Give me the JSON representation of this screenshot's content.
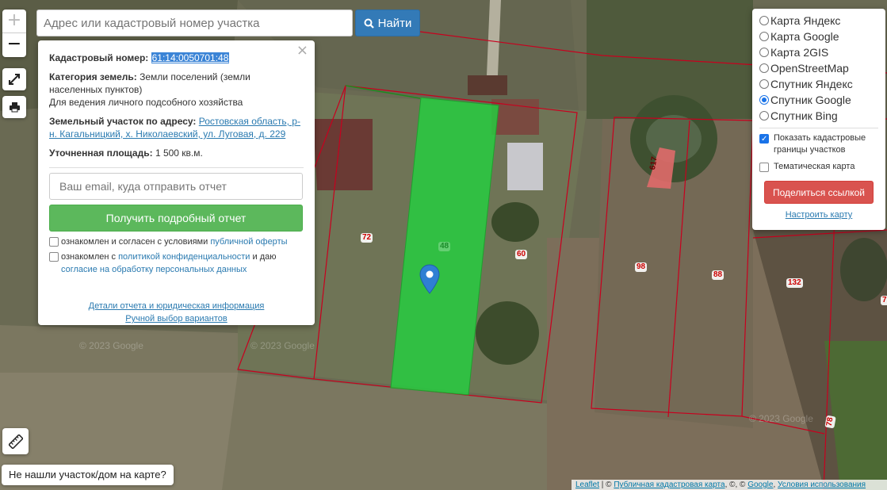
{
  "search": {
    "placeholder": "Адрес или кадастровый номер участка",
    "button_label": "Найти",
    "button_icon": "search-icon"
  },
  "zoom": {
    "in": "+",
    "out": "−"
  },
  "toolbar": {
    "fullscreen_icon": "expand-icon",
    "print_icon": "printer-icon",
    "ruler_icon": "ruler-icon"
  },
  "popup": {
    "close": "×",
    "cadnum_label": "Кадастровый номер:",
    "cadnum_value": "61:14:0050701:48",
    "category_label": "Категория земель:",
    "category_value": "Земли поселений (земли населенных пунктов)",
    "usage": "Для ведения личного подсобного хозяйства",
    "address_label": "Земельный участок по адресу:",
    "address_value": "Ростовская область, р-н. Кагальницкий, х. Николаевский, ул. Луговая, д. 229",
    "area_label": "Уточненная площадь:",
    "area_value": "1 500 кв.м.",
    "email_placeholder": "Ваш email, куда отправить отчет",
    "report_button": "Получить подробный отчет",
    "agree1_prefix": "ознакомлен и согласен с условиями",
    "agree1_link": "публичной оферты",
    "agree2_prefix": "ознакомлен с",
    "agree2_link": "политикой конфиденциальности",
    "agree2_mid": "и даю",
    "agree2_link2": "согласие на обработку персональных данных",
    "link_details": "Детали отчета и юридическая информация",
    "link_manual": "Ручной выбор вариантов"
  },
  "layers": {
    "options": [
      {
        "label": "Карта Яндекс",
        "selected": false
      },
      {
        "label": "Карта Google",
        "selected": false
      },
      {
        "label": "Карта 2GIS",
        "selected": false
      },
      {
        "label": "OpenStreetMap",
        "selected": false
      },
      {
        "label": "Спутник Яндекс",
        "selected": false
      },
      {
        "label": "Спутник Google",
        "selected": true
      },
      {
        "label": "Спутник Bing",
        "selected": false
      }
    ],
    "show_borders": "Показать кадастровые границы участков",
    "show_borders_checked": true,
    "thematic": "Тематическая карта",
    "thematic_checked": false,
    "share_button": "Поделиться ссылкой",
    "setup_link": "Настроить карту"
  },
  "map": {
    "parcel_labels": [
      "72",
      "48",
      "60",
      "98",
      "88",
      "132",
      "617",
      "78",
      "7"
    ],
    "watermark": "© 2023 Google",
    "marker_icon": "map-pin-icon"
  },
  "bottom": {
    "not_found": "Не нашли участок/дом на карте?",
    "attrib_leaflet": "Leaflet",
    "attrib_sep1": " | © ",
    "attrib_pkk": "Публичная кадастровая карта",
    "attrib_sep2": ", ©, © ",
    "attrib_google": "Google",
    "attrib_sep3": ", ",
    "attrib_terms": "Условия использования"
  },
  "colors": {
    "primary": "#337ab7",
    "success": "#5cb85c",
    "danger": "#d9534f",
    "parcel_border": "#c8001e",
    "selected_parcel": "#22c83c"
  }
}
